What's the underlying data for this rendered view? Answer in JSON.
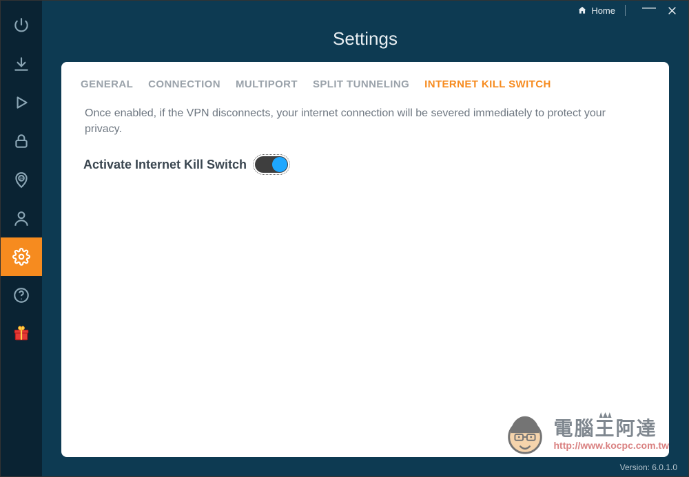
{
  "titlebar": {
    "home_label": "Home"
  },
  "page": {
    "title": "Settings"
  },
  "tabs": {
    "general": "GENERAL",
    "connection": "CONNECTION",
    "multiport": "MULTIPORT",
    "split_tunneling": "SPLIT TUNNELING",
    "kill_switch": "INTERNET KILL SWITCH"
  },
  "content": {
    "description": "Once enabled, if the VPN disconnects, your internet connection will be severed immediately to protect your privacy.",
    "toggle_label": "Activate Internet Kill Switch",
    "toggle_on": true
  },
  "footer": {
    "version": "Version:  6.0.1.0"
  },
  "watermark": {
    "text": "電腦王阿達",
    "url": "http://www.kocpc.com.tw"
  },
  "sidebar_icons": [
    "power",
    "download",
    "play",
    "lock",
    "ip-location",
    "user",
    "settings",
    "help",
    "gift"
  ],
  "colors": {
    "accent": "#f68b1f",
    "bg_dark": "#0d3a52",
    "sidebar": "#0a2333"
  }
}
